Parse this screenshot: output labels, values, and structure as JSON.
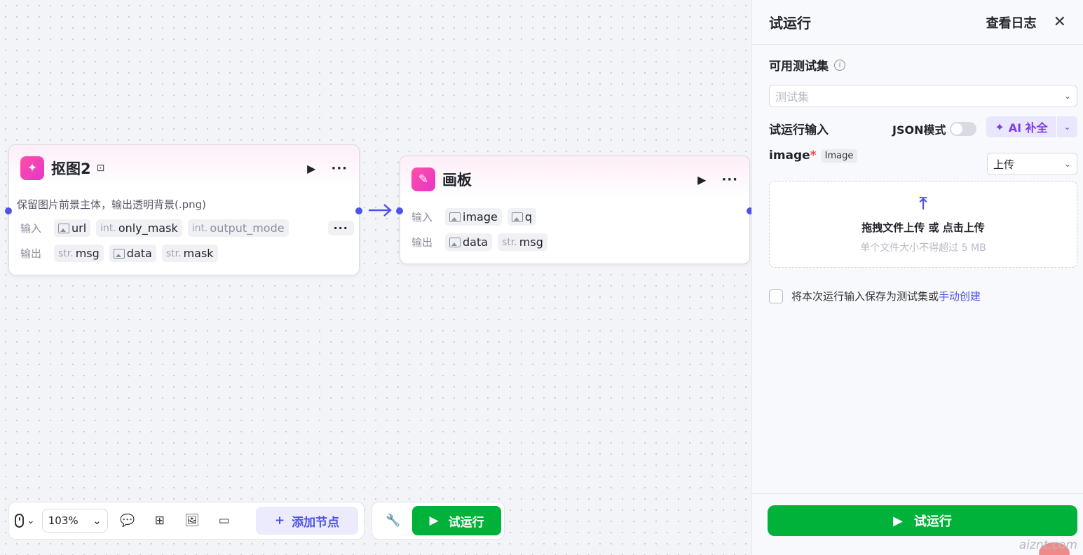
{
  "canvas": {
    "node1": {
      "title": "抠图2",
      "description": "保留图片前景主体，输出透明背景(.png)",
      "input_label": "输入",
      "output_label": "输出",
      "inputs": [
        {
          "type": "image",
          "name": "url"
        },
        {
          "type": "int.",
          "name": "only_mask"
        },
        {
          "type": "int.",
          "name": "output_mode"
        }
      ],
      "more_label": "···",
      "outputs": [
        {
          "type": "str.",
          "name": "msg"
        },
        {
          "type": "image",
          "name": "data"
        },
        {
          "type": "str.",
          "name": "mask"
        }
      ]
    },
    "node2": {
      "title": "画板",
      "input_label": "输入",
      "output_label": "输出",
      "inputs": [
        {
          "type": "image",
          "name": "image"
        },
        {
          "type": "image",
          "name": "q"
        }
      ],
      "outputs": [
        {
          "type": "image",
          "name": "data"
        },
        {
          "type": "str.",
          "name": "msg"
        }
      ]
    },
    "edge_arrow": "→"
  },
  "toolbar": {
    "zoom": "103%",
    "add_node_label": "添加节点",
    "run_label": "试运行"
  },
  "panel": {
    "title": "试运行",
    "log_label": "查看日志",
    "testset_label": "可用测试集",
    "testset_placeholder": "测试集",
    "run_input_label": "试运行输入",
    "json_mode_label": "JSON模式",
    "json_mode_on": false,
    "ai_complete_label": "AI 补全",
    "field": {
      "name": "image",
      "required_mark": "*",
      "type_tag": "Image",
      "source": "上传"
    },
    "dropzone": {
      "main_prefix": "拖拽文件上传 或 ",
      "main_link": "点击上传",
      "hint": "单个文件大小不得超过 5 MB"
    },
    "save_text": "将本次运行输入保存为测试集或",
    "save_link": "手动创建",
    "run_button": "试运行"
  },
  "watermark": "aiznt.com",
  "colors": {
    "accent": "#4d53e8",
    "run_green": "#00b239",
    "node_icon": "#ff4fa5",
    "ai_purple": "#7b3be6"
  }
}
